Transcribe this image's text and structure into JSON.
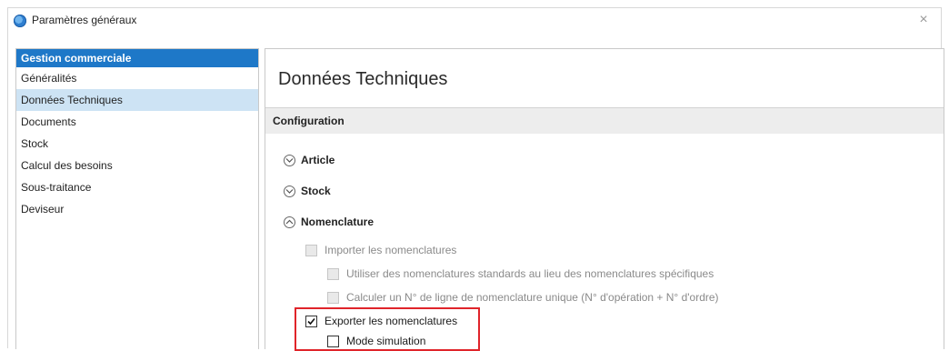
{
  "window": {
    "title": "Paramètres généraux",
    "close_glyph": "×"
  },
  "sidebar": {
    "header": "Gestion commerciale",
    "items": [
      {
        "label": "Généralités",
        "selected": false
      },
      {
        "label": "Données Techniques",
        "selected": true
      },
      {
        "label": "Documents",
        "selected": false
      },
      {
        "label": "Stock",
        "selected": false
      },
      {
        "label": "Calcul des besoins",
        "selected": false
      },
      {
        "label": "Sous-traitance",
        "selected": false
      },
      {
        "label": "Deviseur",
        "selected": false
      }
    ]
  },
  "main": {
    "title": "Données Techniques",
    "section": "Configuration",
    "groups": [
      {
        "label": "Article",
        "expanded": false
      },
      {
        "label": "Stock",
        "expanded": false
      },
      {
        "label": "Nomenclature",
        "expanded": true
      }
    ],
    "options": [
      {
        "label": "Importer les nomenclatures",
        "checked": false,
        "enabled": false
      },
      {
        "label": "Utiliser des nomenclatures standards au lieu des nomenclatures spécifiques",
        "checked": false,
        "enabled": false
      },
      {
        "label": "Calculer un N° de ligne de nomenclature unique (N° d'opération + N° d'ordre)",
        "checked": false,
        "enabled": false
      },
      {
        "label": "Exporter les nomenclatures",
        "checked": true,
        "enabled": true
      },
      {
        "label": "Mode simulation",
        "checked": false,
        "enabled": true
      }
    ]
  },
  "colors": {
    "accent": "#1e78c8",
    "selected_row": "#cde3f4",
    "highlight": "#e0242a"
  },
  "icons": {
    "app": "app-globe-icon",
    "close": "close-icon",
    "collapsed": "chevron-down-icon",
    "expanded": "chevron-up-icon",
    "checked": "checkmark-icon"
  }
}
